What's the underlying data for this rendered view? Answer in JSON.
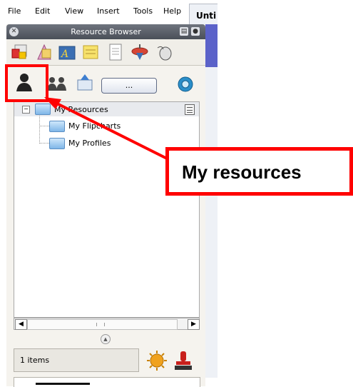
{
  "menubar": {
    "items": [
      "File",
      "Edit",
      "View",
      "Insert",
      "Tools",
      "Help"
    ],
    "doc_tab": "Unti"
  },
  "panel": {
    "title": "Resource Browser",
    "categories": [
      "resource-library-icon",
      "shapes-icon",
      "text-icon",
      "notes-icon",
      "pages-icon",
      "spinning-top-icon",
      "mouse-icon"
    ],
    "toolbar": {
      "more_button": "...",
      "icons": [
        "my-resources-icon",
        "shared-resources-icon",
        "export-icon",
        "search-icon"
      ]
    },
    "tree": {
      "root": "My Resources",
      "children": [
        "My Flipcharts",
        "My Profiles"
      ]
    },
    "item_count": "1 items"
  },
  "callout": {
    "text": "My resources",
    "color": "#ff0000"
  },
  "colors": {
    "title_bar": "#5a5f68",
    "panel_bg": "#f5f3ee",
    "accent_purple": "#5b62c9"
  }
}
